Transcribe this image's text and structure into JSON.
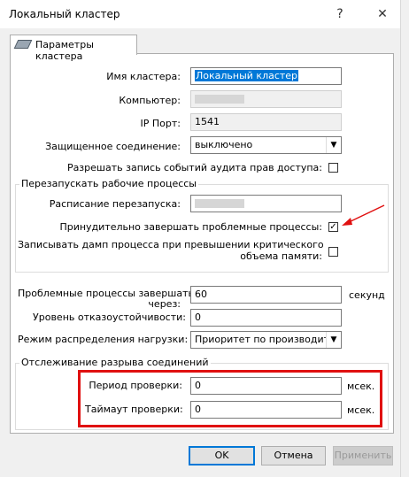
{
  "window": {
    "title": "Локальный кластер",
    "help_glyph": "?",
    "close_glyph": "✕"
  },
  "tab": {
    "label": "Параметры кластера"
  },
  "fields": {
    "cluster_name": {
      "label": "Имя кластера:",
      "value": "Локальный кластер"
    },
    "computer": {
      "label": "Компьютер:"
    },
    "ip_port": {
      "label": "IP Порт:",
      "value": "1541"
    },
    "secure_connection": {
      "label": "Защищенное соединение:",
      "value": "выключено"
    },
    "audit": {
      "label": "Разрешать запись событий аудита прав доступа:",
      "checked": false
    }
  },
  "restart_group": {
    "title": "Перезапускать рабочие процессы",
    "schedule_label": "Расписание перезапуска:",
    "force_terminate_label": "Принудительно завершать проблемные процессы:",
    "force_terminate_checked": true,
    "check_mark": "✓",
    "dump_label_line1": "Записывать дамп процесса при превышении критического",
    "dump_label_line2": "объема памяти:",
    "dump_checked": false
  },
  "problem_processes": {
    "label_line1": "Проблемные процессы завершать",
    "label_line2": "через:",
    "value": "60",
    "unit": "секунд"
  },
  "fault_tolerance": {
    "label": "Уровень отказоустойчивости:",
    "value": "0"
  },
  "load_balancing": {
    "label": "Режим распределения нагрузки:",
    "value": "Приоритет по производитель"
  },
  "connection_group": {
    "title": "Отслеживание разрыва соединений",
    "check_period": {
      "label": "Период проверки:",
      "value": "0",
      "unit": "мсек."
    },
    "check_timeout": {
      "label": "Таймаут проверки:",
      "value": "0",
      "unit": "мсек."
    }
  },
  "buttons": {
    "ok": "OK",
    "cancel": "Отмена",
    "apply": "Применить"
  },
  "colors": {
    "highlight_border": "#e01010",
    "annotation_arrow": "#e01010",
    "selection": "#0078d7"
  }
}
